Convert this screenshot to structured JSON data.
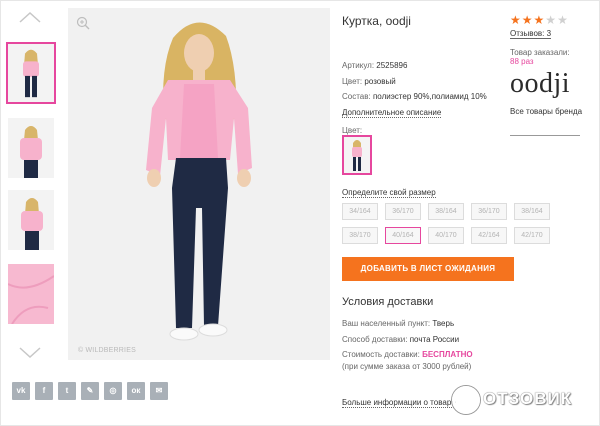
{
  "product": {
    "title": "Куртка, oodji",
    "article_label": "Артикул:",
    "article_value": "2525896",
    "color_label": "Цвет:",
    "color_value": "розовый",
    "composition_label": "Состав:",
    "composition_value": "полиэстер 90%,полиамид 10%",
    "more_description": "Дополнительное описание",
    "swatch_label": "Цвет:"
  },
  "photo": {
    "watermark": "© WILDBERRIES"
  },
  "sizes": {
    "link": "Определите свой размер",
    "items": [
      "34/164",
      "36/170",
      "38/164",
      "36/170",
      "38/164",
      "38/170",
      "40/164",
      "40/170",
      "42/164",
      "42/170"
    ],
    "selected": "40/164"
  },
  "actions": {
    "wait_list": "ДОБАВИТЬ В ЛИСТ ОЖИДАНИЯ"
  },
  "delivery": {
    "title": "Условия доставки",
    "city_label": "Ваш населенный пункт:",
    "city_value": "Тверь",
    "method_label": "Способ доставки:",
    "method_value": "почта России",
    "cost_label": "Стоимость доставки:",
    "cost_value": "БЕСПЛАТНО",
    "cost_note": "(при сумме заказа от 3000 рублей)",
    "more": "Больше информации о товаре"
  },
  "rating": {
    "stars_filled": 3,
    "stars_total": 5,
    "reviews": "Отзывов: 3",
    "ordered_label": "Товар заказали:",
    "ordered_count": "88 раз"
  },
  "brand": {
    "logo": "oodji",
    "all_items": "Все товары бренда"
  },
  "social": [
    "vk",
    "facebook",
    "twitter",
    "livejournal",
    "odnoklassniki-circle",
    "odnoklassniki",
    "mail"
  ],
  "social_glyphs": [
    "vk",
    "f",
    "t",
    "✎",
    "◎",
    "ок",
    "✉"
  ],
  "site_watermark": "ОТЗОВИК",
  "colors": {
    "accent": "#e6479e",
    "button": "#f5731e",
    "jacket": "#f7b2cc"
  }
}
